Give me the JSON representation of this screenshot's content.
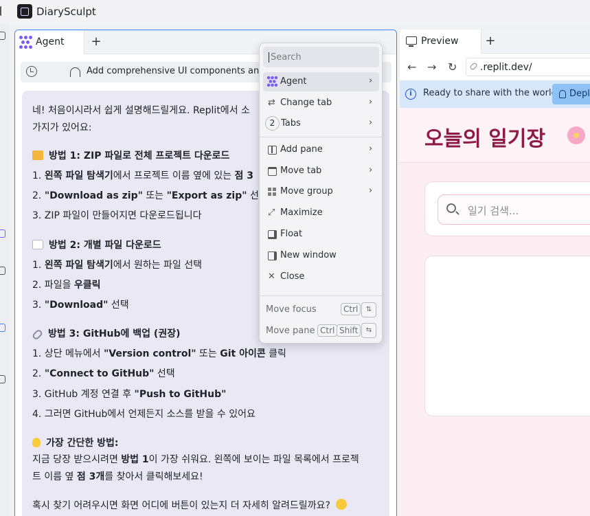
{
  "app": {
    "title": "DiarySculpt",
    "logo_icon": "book-icon"
  },
  "agent_pane": {
    "tab_label": "Agent",
    "tab_icon": "agent-dots-icon",
    "add_tab": "+",
    "subbar": {
      "history_icon": "history-icon",
      "text": "Add comprehensive UI components and la"
    },
    "message": {
      "intro_1": "네! 처음이시라서 쉽게 설명해드릴게요. Replit에서 소",
      "intro_2": "가지가 있어요:",
      "m1_title": "방법 1: ZIP 파일로 전체 프로젝트 다운로드",
      "m1_s1_prefix": "1. ",
      "m1_s1_bold": "왼쪽 파일 탐색기",
      "m1_s1_rest": "에서 프로젝트 이름 옆에 있는 ",
      "m1_s1_bold2": "점 3",
      "m1_s2_prefix": "2. ",
      "m1_s2_bold1": "\"Download as zip\"",
      "m1_s2_mid": " 또는 ",
      "m1_s2_bold2": "\"Export as zip\"",
      "m1_s2_rest": " 선택",
      "m1_s3": "3. ZIP 파일이 만들어지면 다운로드됩니다",
      "m2_title": "방법 2: 개별 파일 다운로드",
      "m2_s1_prefix": "1. ",
      "m2_s1_bold": "왼쪽 파일 탐색기",
      "m2_s1_rest": "에서 원하는 파일 선택",
      "m2_s2_prefix": "2. 파일을 ",
      "m2_s2_bold": "우클릭",
      "m2_s3_prefix": "3. ",
      "m2_s3_bold": "\"Download\"",
      "m2_s3_rest": " 선택",
      "m3_title": "방법 3: GitHub에 백업 (권장)",
      "m3_s1_prefix": "1. 상단 메뉴에서 ",
      "m3_s1_bold1": "\"Version control\"",
      "m3_s1_mid": " 또는 ",
      "m3_s1_bold2": "Git 아이콘",
      "m3_s1_rest": " 클릭",
      "m3_s2_prefix": "2. ",
      "m3_s2_bold": "\"Connect to GitHub\"",
      "m3_s2_rest": " 선택",
      "m3_s3_prefix": "3. GitHub 계정 연결 후 ",
      "m3_s3_bold": "\"Push to GitHub\"",
      "m3_s4": "4. 그러면 GitHub에서 언제든지 소스를 받을 수 있어요",
      "tip_title": "가장 간단한 방법:",
      "tip_1_prefix": "지금 당장 받으시려면 ",
      "tip_1_bold": "방법 1",
      "tip_1_rest": "이 가장 쉬워요. 왼쪽에 보이는 파일 목록에서 프로젝",
      "tip_2_prefix": "트 이름 옆 ",
      "tip_2_bold": "점 3개",
      "tip_2_rest": "를 찾아서 클릭해보세요!",
      "closing": "혹시 찾기 어려우시면 화면 어디에 버튼이 있는지 더 자세히 알려드릴까요?"
    }
  },
  "context_menu": {
    "search_placeholder": "Search",
    "items": [
      {
        "label": "Agent",
        "icon": "agent-dots-icon",
        "submenu": true
      },
      {
        "label": "Change tab",
        "icon": "swap-icon",
        "submenu": true
      },
      {
        "label": "Tabs",
        "badge": "2",
        "submenu": true
      },
      {
        "label": "Add pane",
        "icon": "split-pane-icon",
        "submenu": true
      },
      {
        "label": "Move tab",
        "icon": "tab-icon",
        "submenu": true
      },
      {
        "label": "Move group",
        "icon": "grid-icon",
        "submenu": true
      },
      {
        "label": "Maximize",
        "icon": "expand-icon",
        "submenu": false
      },
      {
        "label": "Float",
        "icon": "float-icon",
        "submenu": false
      },
      {
        "label": "New window",
        "icon": "new-window-icon",
        "submenu": false
      },
      {
        "label": "Close",
        "icon": "close-icon",
        "submenu": false
      }
    ],
    "move_focus": {
      "label": "Move focus",
      "key1": "Ctrl"
    },
    "move_pane": {
      "label": "Move pane",
      "key1": "Ctrl",
      "key2": "Shift"
    }
  },
  "preview_pane": {
    "tab_label": "Preview",
    "add_tab": "+",
    "url": ".replit.dev/",
    "share_text": "Ready to share with the world?",
    "deploy_label": "Depl",
    "diary_title": "오늘의 일기장",
    "search_placeholder": "일기 검색..."
  },
  "colors": {
    "accent": "#3b82f6",
    "agent_purple": "#7c5cf0",
    "diary_title": "#8d1a45",
    "share_bar": "#d9e7fb"
  }
}
